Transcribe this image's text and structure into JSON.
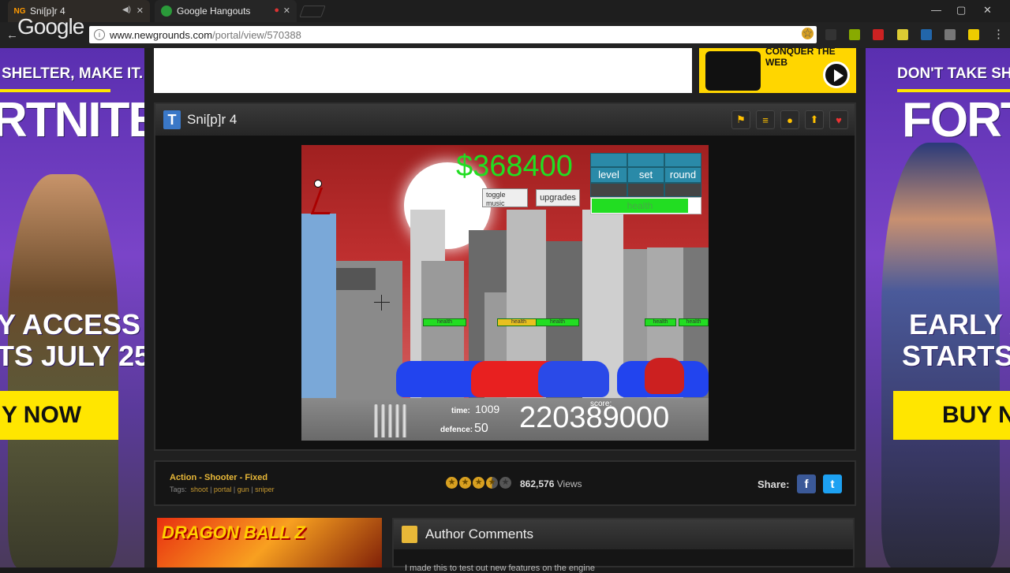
{
  "browser": {
    "tabs": [
      {
        "title": "Sni[p]r 4",
        "favicon": "NG"
      },
      {
        "title": "Google Hangouts"
      }
    ],
    "overlay_logo": "Google",
    "url_host": "www.newgrounds.com",
    "url_path": "/portal/view/570388"
  },
  "ads": {
    "left": {
      "line1": "SHELTER, MAKE IT.",
      "brand": "RTNITE",
      "line2": "Y ACCESS",
      "line3": "TS JULY 25",
      "buy": "Y NOW"
    },
    "right": {
      "line1": "DON'T TAKE SHELTE",
      "brand": "FORTN",
      "line2": "EARLY AC",
      "line3": "STARTS J",
      "buy": "BUY NO"
    },
    "conquer": "CONQUER THE WEB"
  },
  "game_panel": {
    "title": "Sni[p]r 4",
    "header_icons": [
      "flag-icon",
      "menu-icon",
      "search-icon",
      "upload-icon",
      "heart-icon"
    ]
  },
  "game": {
    "money": "$368400",
    "toggle_music": "toggle music",
    "upgrades": "upgrades",
    "stat_labels": [
      "level",
      "set",
      "round"
    ],
    "health_label": "health",
    "health_fraction": 0.89,
    "tank_health_label": "health",
    "time_label": "time:",
    "time_value": "1009",
    "defence_label": "defence:",
    "defence_value": "50",
    "score_label": "score:",
    "score_value": "220389000",
    "bullets": 5
  },
  "info": {
    "genre": "Action - Shooter - Fixed",
    "tags_label": "Tags:",
    "tags": [
      "shoot",
      "portal",
      "gun",
      "sniper"
    ],
    "rating_stars": 3.5,
    "views_count": "862,576",
    "views_label": "Views",
    "share_label": "Share:"
  },
  "bottom": {
    "dbz_text": "DRAGON BALL Z",
    "author_comments": "Author Comments",
    "comment_snippet": "I made this to test out new features on the engine"
  }
}
